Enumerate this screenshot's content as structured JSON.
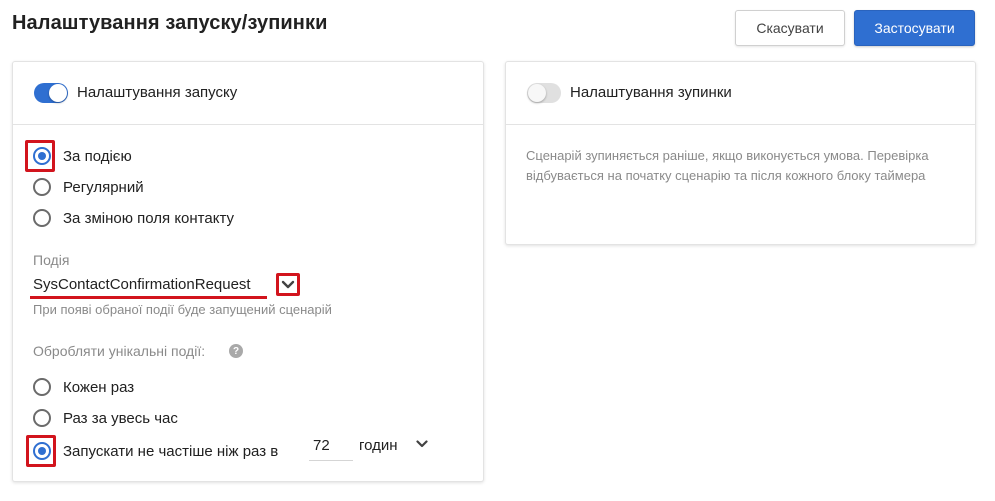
{
  "header": {
    "title": "Налаштування запуску/зупинки",
    "cancel_label": "Скасувати",
    "apply_label": "Застосувати"
  },
  "start_settings": {
    "toggle_on": true,
    "title": "Налаштування запуску",
    "trigger_options": [
      {
        "label": "За подією",
        "checked": true
      },
      {
        "label": "Регулярний",
        "checked": false
      },
      {
        "label": "За зміною поля контакту",
        "checked": false
      }
    ],
    "event_label": "Подія",
    "event_value": "SysContactConfirmationRequest",
    "event_hint": "При появі обраної події буде запущений сценарій",
    "unique_label": "Обробляти унікальні події:",
    "unique_options": [
      {
        "label": "Кожен раз",
        "checked": false
      },
      {
        "label": "Раз за увесь час",
        "checked": false
      },
      {
        "label": "Запускати не частіше ніж раз в",
        "checked": true
      }
    ],
    "hours_value": "72",
    "unit_value": "годин"
  },
  "stop_settings": {
    "toggle_on": false,
    "title": "Налаштування зупинки",
    "description": "Сценарій зупиняється раніше, якщо виконується умова. Перевірка відбувається на початку сценарію та після кожного блоку таймера"
  },
  "colors": {
    "accent": "#2f6fd1",
    "highlight": "#d2141d"
  }
}
